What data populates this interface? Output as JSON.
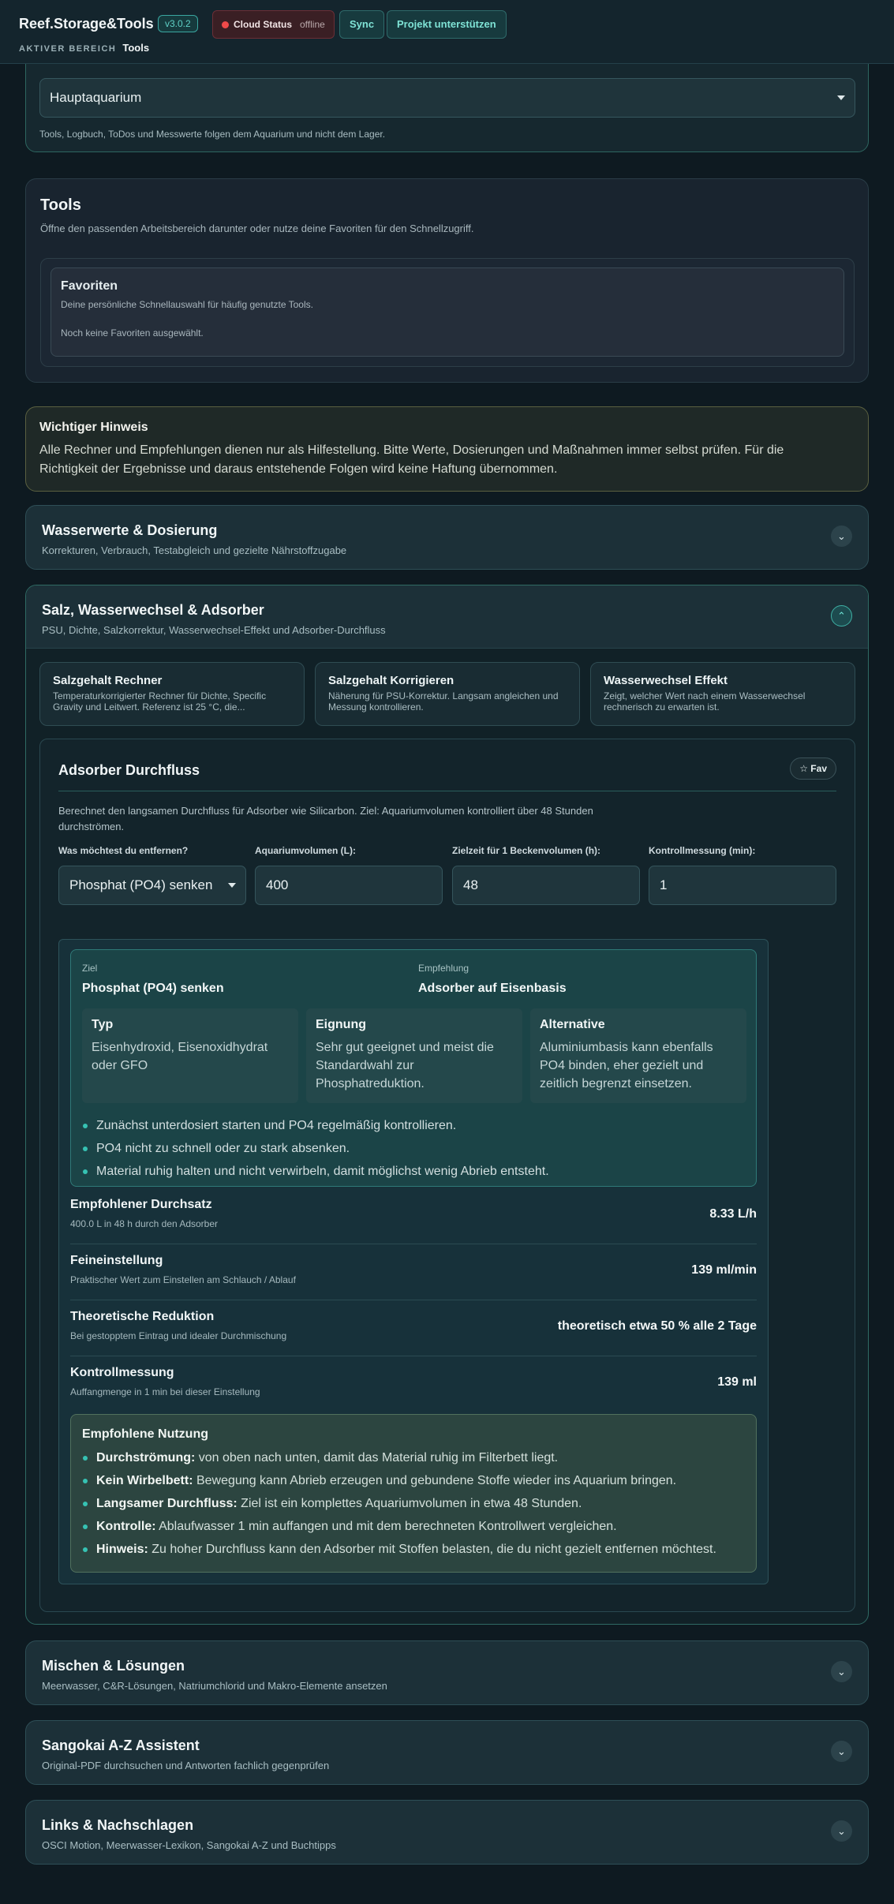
{
  "header": {
    "brand": "Reef.Storage&Tools",
    "version": "v3.0.2",
    "cloud_label": "Cloud Status",
    "cloud_state": "offline",
    "sync_label": "Sync",
    "support_label": "Projekt unterstützen",
    "breadcrumb_label": "AKTIVER BEREICH",
    "breadcrumb_value": "Tools"
  },
  "aquarium": {
    "selected": "Hauptaquarium",
    "hint": "Tools, Logbuch, ToDos und Messwerte folgen dem Aquarium und nicht dem Lager."
  },
  "tools": {
    "title": "Tools",
    "subtitle": "Öffne den passenden Arbeitsbereich darunter oder nutze deine Favoriten für den Schnellzugriff.",
    "favorites_title": "Favoriten",
    "favorites_sub": "Deine persönliche Schnellauswahl für häufig genutzte Tools.",
    "favorites_empty": "Noch keine Favoriten ausgewählt."
  },
  "notice": {
    "title": "Wichtiger Hinweis",
    "text": "Alle Rechner und Empfehlungen dienen nur als Hilfestellung. Bitte Werte, Dosierungen und Maßnahmen immer selbst prüfen. Für die Richtigkeit der Ergebnisse und daraus entstehende Folgen wird keine Haftung übernommen."
  },
  "sections": {
    "wasser": {
      "title": "Wasserwerte & Dosierung",
      "subtitle": "Korrekturen, Verbrauch, Testabgleich und gezielte Nährstoffzugabe"
    },
    "salz": {
      "title": "Salz, Wasserwechsel & Adsorber",
      "subtitle": "PSU, Dichte, Salzkorrektur, Wasserwechsel-Effekt und Adsorber-Durchfluss"
    },
    "mischen": {
      "title": "Mischen & Lösungen",
      "subtitle": "Meerwasser, C&R-Lösungen, Natriumchlorid und Makro-Elemente ansetzen"
    },
    "sangokai": {
      "title": "Sangokai A-Z Assistent",
      "subtitle": "Original-PDF durchsuchen und Antworten fachlich gegenprüfen"
    },
    "links": {
      "title": "Links & Nachschlagen",
      "subtitle": "OSCI Motion, Meerwasser-Lexikon, Sangokai A-Z und Buchtipps"
    }
  },
  "mini_tools": [
    {
      "title": "Salzgehalt Rechner",
      "sub": "Temperaturkorrigierter Rechner für Dichte, Specific Gravity und Leitwert. Referenz ist 25 °C, die..."
    },
    {
      "title": "Salzgehalt Korrigieren",
      "sub": "Näherung für PSU-Korrektur. Langsam angleichen und Messung kontrollieren."
    },
    {
      "title": "Wasserwechsel Effekt",
      "sub": "Zeigt, welcher Wert nach einem Wasserwechsel rechnerisch zu erwarten ist."
    }
  ],
  "adsorber": {
    "title": "Adsorber Durchfluss",
    "fav_label": "☆ Fav",
    "description": "Berechnet den langsamen Durchfluss für Adsorber wie Silicarbon. Ziel: Aquariumvolumen kontrolliert über 48 Stunden durchströmen.",
    "labels": {
      "remove": "Was möchtest du entfernen?",
      "volume": "Aquariumvolumen (L):",
      "time": "Zielzeit für 1 Beckenvolumen (h):",
      "check": "Kontrollmessung (min):"
    },
    "values": {
      "remove": "Phosphat (PO4) senken",
      "volume": "400",
      "time": "48",
      "check": "1"
    },
    "goal_label": "Ziel",
    "goal_value": "Phosphat (PO4) senken",
    "rec_label": "Empfehlung",
    "rec_value": "Adsorber auf Eisenbasis",
    "boxes": [
      {
        "title": "Typ",
        "text": "Eisenhydroxid, Eisenoxidhydrat oder GFO"
      },
      {
        "title": "Eignung",
        "text": "Sehr gut geeignet und meist die Standardwahl zur Phosphatreduktion."
      },
      {
        "title": "Alternative",
        "text": "Aluminiumbasis kann ebenfalls PO4 binden, eher gezielt und zeitlich begrenzt einsetzen."
      }
    ],
    "tips": [
      "Zunächst unterdosiert starten und PO4 regelmäßig kontrollieren.",
      "PO4 nicht zu schnell oder zu stark absenken.",
      "Material ruhig halten und nicht verwirbeln, damit möglichst wenig Abrieb entsteht."
    ],
    "rows": [
      {
        "title": "Empfohlener Durchsatz",
        "sub": "400.0 L in 48 h durch den Adsorber",
        "value": "8.33 L/h"
      },
      {
        "title": "Feineinstellung",
        "sub": "Praktischer Wert zum Einstellen am Schlauch / Ablauf",
        "value": "139 ml/min"
      },
      {
        "title": "Theoretische Reduktion",
        "sub": "Bei gestopptem Eintrag und idealer Durchmischung",
        "value": "theoretisch etwa 50 % alle 2 Tage"
      },
      {
        "title": "Kontrollmessung",
        "sub": "Auffangmenge in 1 min bei dieser Einstellung",
        "value": "139 ml"
      }
    ],
    "usage_title": "Empfohlene Nutzung",
    "usage": [
      {
        "key": "Durchströmung:",
        "text": " von oben nach unten, damit das Material ruhig im Filterbett liegt."
      },
      {
        "key": "Kein Wirbelbett:",
        "text": " Bewegung kann Abrieb erzeugen und gebundene Stoffe wieder ins Aquarium bringen."
      },
      {
        "key": "Langsamer Durchfluss:",
        "text": " Ziel ist ein komplettes Aquariumvolumen in etwa 48 Stunden."
      },
      {
        "key": "Kontrolle:",
        "text": " Ablaufwasser 1 min auffangen und mit dem berechneten Kontrollwert vergleichen."
      },
      {
        "key": "Hinweis:",
        "text": " Zu hoher Durchfluss kann den Adsorber mit Stoffen belasten, die du nicht gezielt entfernen möchtest."
      }
    ]
  }
}
